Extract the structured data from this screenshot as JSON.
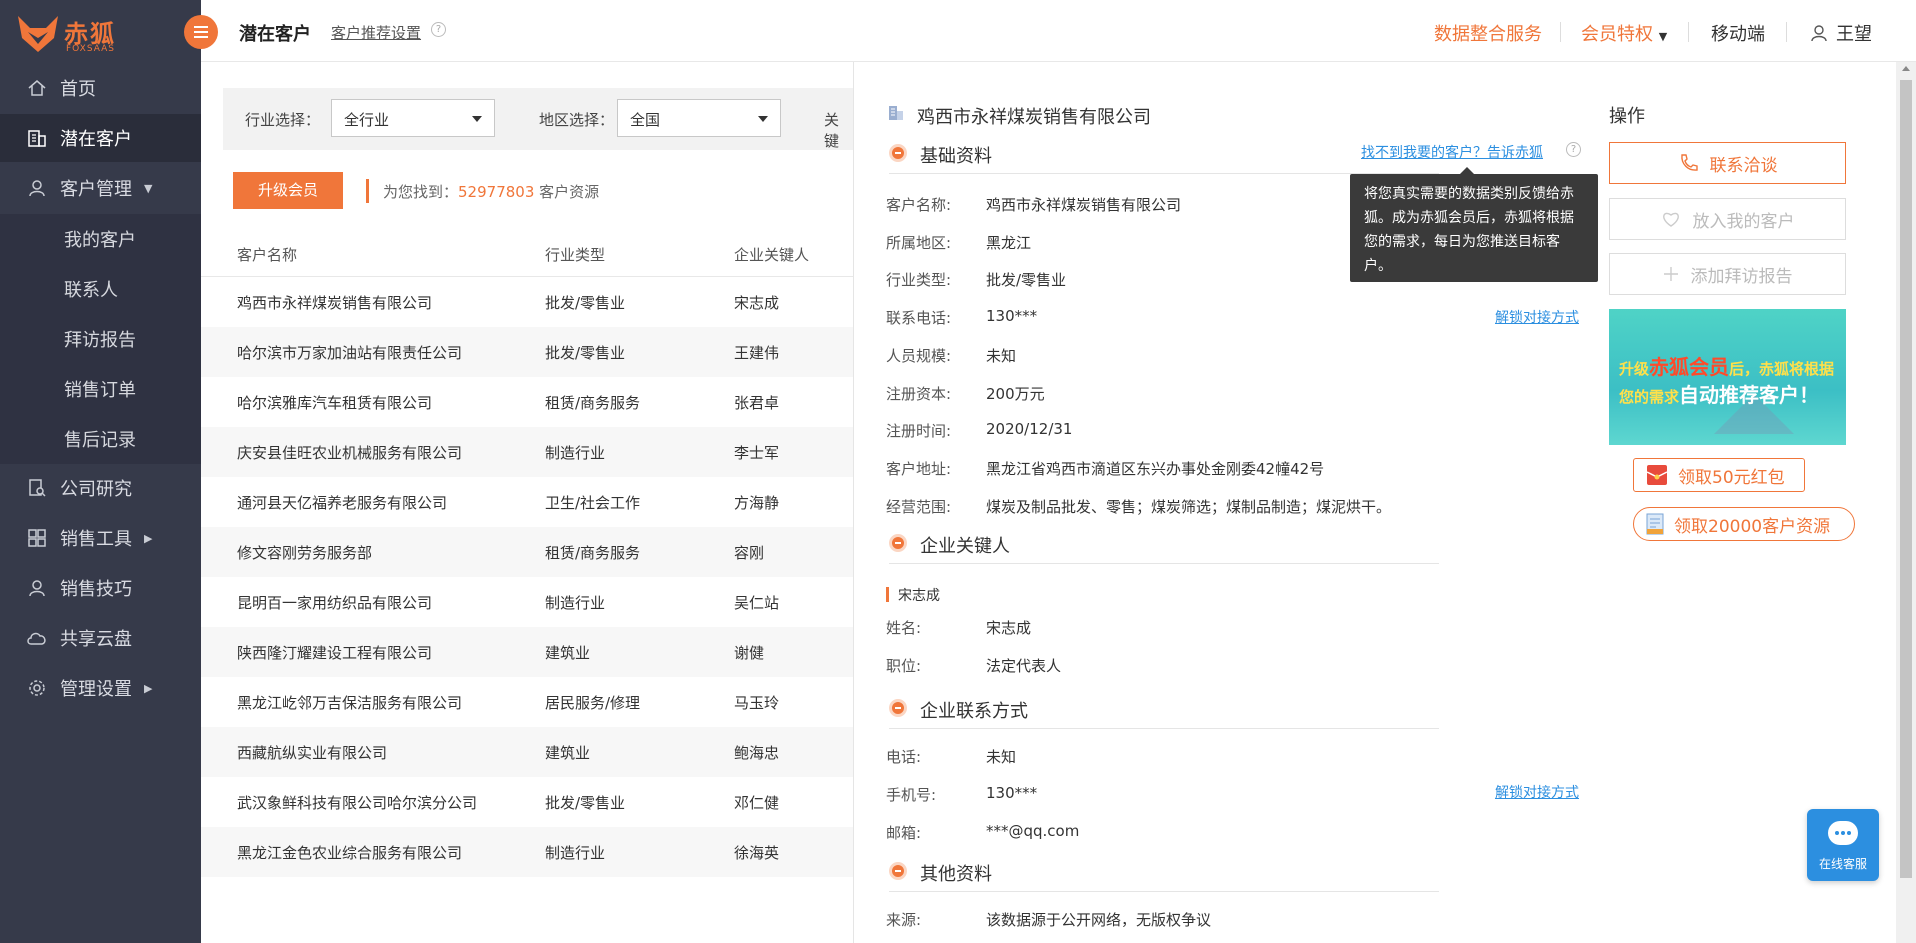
{
  "app": {
    "logo_cn": "赤狐",
    "logo_en": "FOXSAAS",
    "brand_color": "#f0763a"
  },
  "sidebar": {
    "items": [
      {
        "label": "首页",
        "icon": "home-icon"
      },
      {
        "label": "潜在客户",
        "icon": "building-icon"
      },
      {
        "label": "客户管理",
        "icon": "user-icon"
      },
      {
        "label": "公司研究",
        "icon": "document-search-icon"
      },
      {
        "label": "销售工具",
        "icon": "grid-icon"
      },
      {
        "label": "销售技巧",
        "icon": "person-icon"
      },
      {
        "label": "共享云盘",
        "icon": "cloud-icon"
      },
      {
        "label": "管理设置",
        "icon": "gear-icon"
      }
    ],
    "sub_items": [
      "我的客户",
      "联系人",
      "拜访报告",
      "销售订单",
      "售后记录"
    ]
  },
  "header": {
    "title": "潜在客户",
    "settings_link": "客户推荐设置",
    "help": "?",
    "data_service": "数据整合服务",
    "vip": "会员特权",
    "mobile": "移动端",
    "user": "王望"
  },
  "filters": {
    "industry_label": "行业选择：",
    "industry_value": "全行业",
    "region_label": "地区选择：",
    "region_value": "全国",
    "keyword_label": "关键"
  },
  "upgrade_button": "升级会员",
  "found": {
    "prefix": "为您找到：",
    "count": "52977803",
    "suffix": " 客户资源"
  },
  "table": {
    "headers": [
      "客户名称",
      "行业类型",
      "企业关键人"
    ],
    "rows": [
      [
        "鸡西市永祥煤炭销售有限公司",
        "批发/零售业",
        "宋志成"
      ],
      [
        "哈尔滨市万家加油站有限责任公司",
        "批发/零售业",
        "王建伟"
      ],
      [
        "哈尔滨雅库汽车租赁有限公司",
        "租赁/商务服务",
        "张君卓"
      ],
      [
        "庆安县佳旺农业机械服务有限公司",
        "制造行业",
        "李士军"
      ],
      [
        "通河县天亿福养老服务有限公司",
        "卫生/社会工作",
        "方海静"
      ],
      [
        "修文容刚劳务服务部",
        "租赁/商务服务",
        "容刚"
      ],
      [
        "昆明百一家用纺织品有限公司",
        "制造行业",
        "吴仁站"
      ],
      [
        "陕西隆汀耀建设工程有限公司",
        "建筑业",
        "谢健"
      ],
      [
        "黑龙江屹邻万吉保洁服务有限公司",
        "居民服务/修理",
        "马玉玲"
      ],
      [
        "西藏航纵实业有限公司",
        "建筑业",
        "鲍海忠"
      ],
      [
        "武汉象鲜科技有限公司哈尔滨分公司",
        "批发/零售业",
        "邓仁健"
      ],
      [
        "黑龙江金色农业综合服务有限公司",
        "制造行业",
        "徐海英"
      ]
    ]
  },
  "detail": {
    "company": "鸡西市永祥煤炭销售有限公司",
    "sections": {
      "basic": "基础资料",
      "key_person": "企业关键人",
      "contact": "企业联系方式",
      "other": "其他资料"
    },
    "feedback_link": "找不到我要的客户？告诉赤狐",
    "tooltip": "将您真实需要的数据类别反馈给赤狐。成为赤狐会员后，赤狐将根据您的需求，每日为您推送目标客户。",
    "unlock_link": "解锁对接方式",
    "basic_fields": [
      {
        "k": "客户名称:",
        "v": "鸡西市永祥煤炭销售有限公司"
      },
      {
        "k": "所属地区:",
        "v": "黑龙江"
      },
      {
        "k": "行业类型:",
        "v": "批发/零售业"
      },
      {
        "k": "联系电话:",
        "v": "130***"
      },
      {
        "k": "人员规模:",
        "v": "未知"
      },
      {
        "k": "注册资本:",
        "v": "200万元"
      },
      {
        "k": "注册时间:",
        "v": "2020/12/31"
      },
      {
        "k": "客户地址:",
        "v": "黑龙江省鸡西市滴道区东兴办事处金刚委42幢42号"
      },
      {
        "k": "经营范围:",
        "v": "煤炭及制品批发、零售；煤炭筛选；煤制品制造；煤泥烘干。"
      }
    ],
    "key_person_name": "宋志成",
    "key_fields": [
      {
        "k": "姓名:",
        "v": "宋志成"
      },
      {
        "k": "职位:",
        "v": "法定代表人"
      }
    ],
    "contact_fields": [
      {
        "k": "电话:",
        "v": "未知"
      },
      {
        "k": "手机号:",
        "v": "130***"
      },
      {
        "k": "邮箱:",
        "v": "***@qq.com"
      }
    ],
    "other_fields": [
      {
        "k": "来源:",
        "v": "该数据源于公开网络，无版权争议"
      }
    ]
  },
  "ops": {
    "title": "操作",
    "contact_btn": "联系洽谈",
    "favorite_btn": "放入我的客户",
    "report_btn": "添加拜访报告",
    "promo_line1_a": "升级",
    "promo_line1_b": "赤狐会员",
    "promo_line1_c": "后，赤狐将根据",
    "promo_line2_a": "您的需求",
    "promo_line2_b": "自动推荐客户！",
    "redpacket": "领取50元红包",
    "resources": "领取20000客户资源"
  },
  "chat": {
    "label": "在线客服"
  }
}
